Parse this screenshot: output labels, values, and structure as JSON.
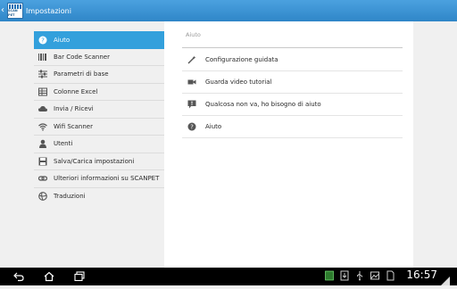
{
  "actionbar": {
    "title": "Impostazioni",
    "app_icon_text": "SCAN PET"
  },
  "sidebar": {
    "items": [
      {
        "label": "Aiuto",
        "icon": "help-icon",
        "active": true
      },
      {
        "label": "Bar Code Scanner",
        "icon": "barcode-icon"
      },
      {
        "label": "Parametri di base",
        "icon": "sliders-icon"
      },
      {
        "label": "Colonne Excel",
        "icon": "table-icon"
      },
      {
        "label": "Invia / Ricevi",
        "icon": "cloud-icon"
      },
      {
        "label": "Wifi Scanner",
        "icon": "wifi-icon"
      },
      {
        "label": "Utenti",
        "icon": "user-icon"
      },
      {
        "label": "Salva/Carica impostazioni",
        "icon": "save-icon"
      },
      {
        "label": "Ulteriori informazioni su SCANPET",
        "icon": "link-icon"
      },
      {
        "label": "Traduzioni",
        "icon": "globe-icon"
      }
    ]
  },
  "detail": {
    "section_title": "Aiuto",
    "options": [
      {
        "label": "Configurazione guidata",
        "icon": "magic-wand-icon"
      },
      {
        "label": "Guarda video tutorial",
        "icon": "video-camera-icon"
      },
      {
        "label": "Qualcosa non va, ho bisogno di aiuto",
        "icon": "alert-chat-icon"
      },
      {
        "label": "Aiuto",
        "icon": "help-icon"
      }
    ]
  },
  "statusbar": {
    "time": "16:57"
  },
  "colors": {
    "accent": "#33a0dc",
    "actionbar": "#2f86c8"
  }
}
